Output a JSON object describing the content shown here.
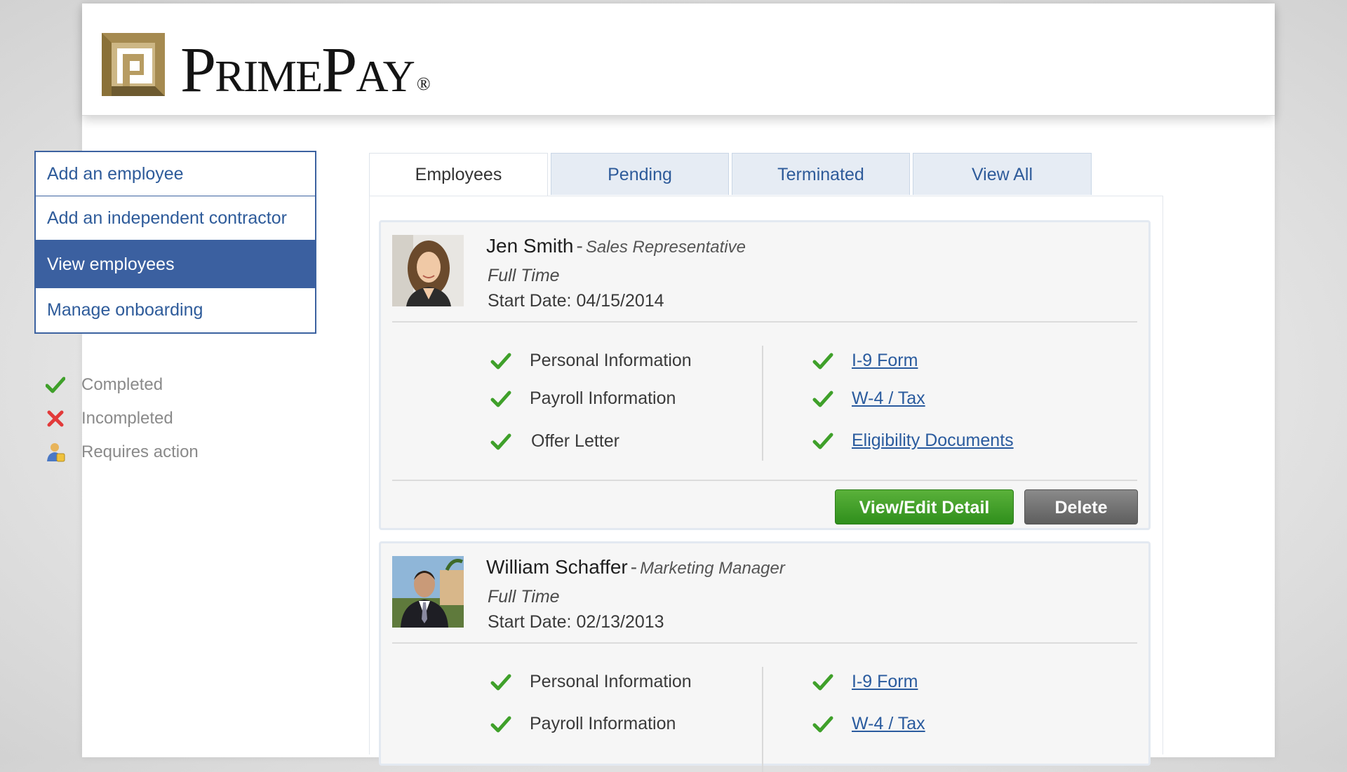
{
  "brand": {
    "name": "PrimePay",
    "registered_mark": "®",
    "colors": {
      "logo_gold": "#a58a50",
      "logo_dark": "#6d5a30"
    }
  },
  "sidebar": {
    "items": [
      {
        "label": "Add an employee",
        "active": false
      },
      {
        "label": "Add an independent contractor",
        "active": false
      },
      {
        "label": "View employees",
        "active": true
      },
      {
        "label": "Manage onboarding",
        "active": false
      }
    ]
  },
  "legend": {
    "completed": {
      "label": "Completed",
      "icon": "green-check-icon"
    },
    "incompleted": {
      "label": "Incompleted",
      "icon": "red-x-icon"
    },
    "requires_action": {
      "label": "Requires action",
      "icon": "person-action-icon"
    }
  },
  "tabs": [
    {
      "label": "Employees",
      "active": true
    },
    {
      "label": "Pending",
      "active": false
    },
    {
      "label": "Terminated",
      "active": false
    },
    {
      "label": "View All",
      "active": false
    }
  ],
  "employees": [
    {
      "name": "Jen Smith",
      "separator": "-",
      "role": "Sales Representative",
      "type": "Full Time",
      "start": "Start Date: 04/15/2014",
      "left_items": [
        "Personal Information",
        "Payroll Information",
        "Offer Letter"
      ],
      "right_items": [
        "I-9 Form",
        "W-4 / Tax",
        "Eligibility Documents"
      ],
      "view_edit_label": "View/Edit Detail",
      "delete_label": "Delete"
    },
    {
      "name": "William Schaffer",
      "separator": "-",
      "role": "Marketing Manager",
      "type": "Full Time",
      "start": "Start Date: 02/13/2013",
      "left_items": [
        "Personal Information",
        "Payroll Information"
      ],
      "right_items": [
        "I-9 Form",
        "W-4 / Tax"
      ]
    }
  ],
  "colors": {
    "nav_blue": "#3b60a0",
    "link_blue": "#2a5b9e",
    "check_green": "#3fa02a",
    "x_red": "#e23a3a",
    "button_green": "#3f9f26",
    "button_gray": "#6f6f6f"
  }
}
